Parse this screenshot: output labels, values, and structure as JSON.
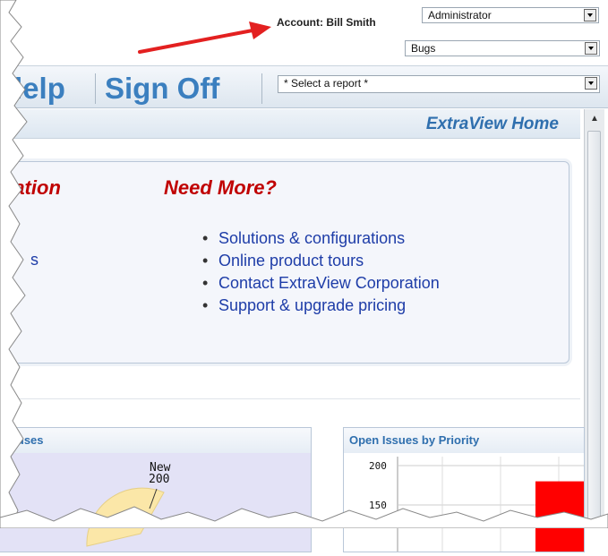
{
  "account": {
    "label": "Account: Bill Smith"
  },
  "role_select": {
    "value": "Administrator"
  },
  "area_select": {
    "value": "Bugs"
  },
  "menu": {
    "help": "lelp",
    "sign_off": "Sign Off"
  },
  "report_select": {
    "value": "* Select a report *"
  },
  "home": {
    "title": "ExtraView Home"
  },
  "panel": {
    "left_heading": "tation",
    "right_heading": "Need More?",
    "left_fragment": "s",
    "links": [
      "Solutions & configurations",
      "Online product tours",
      "Contact ExtraView Corporation",
      "Support & upgrade pricing"
    ]
  },
  "widgets": {
    "statuses": {
      "title": "tatuses",
      "slice_label": "New",
      "slice_value": "200",
      "slice_color": "#fbe7a8"
    },
    "priority": {
      "title": "Open Issues by Priority",
      "y_ticks": [
        "200",
        "150"
      ],
      "bar_color": "#ff0000",
      "bar_value": 180
    }
  },
  "colors": {
    "arrow": "#e32020",
    "link": "#1e3da8",
    "heading": "#c00000",
    "accent": "#2f6fae"
  }
}
